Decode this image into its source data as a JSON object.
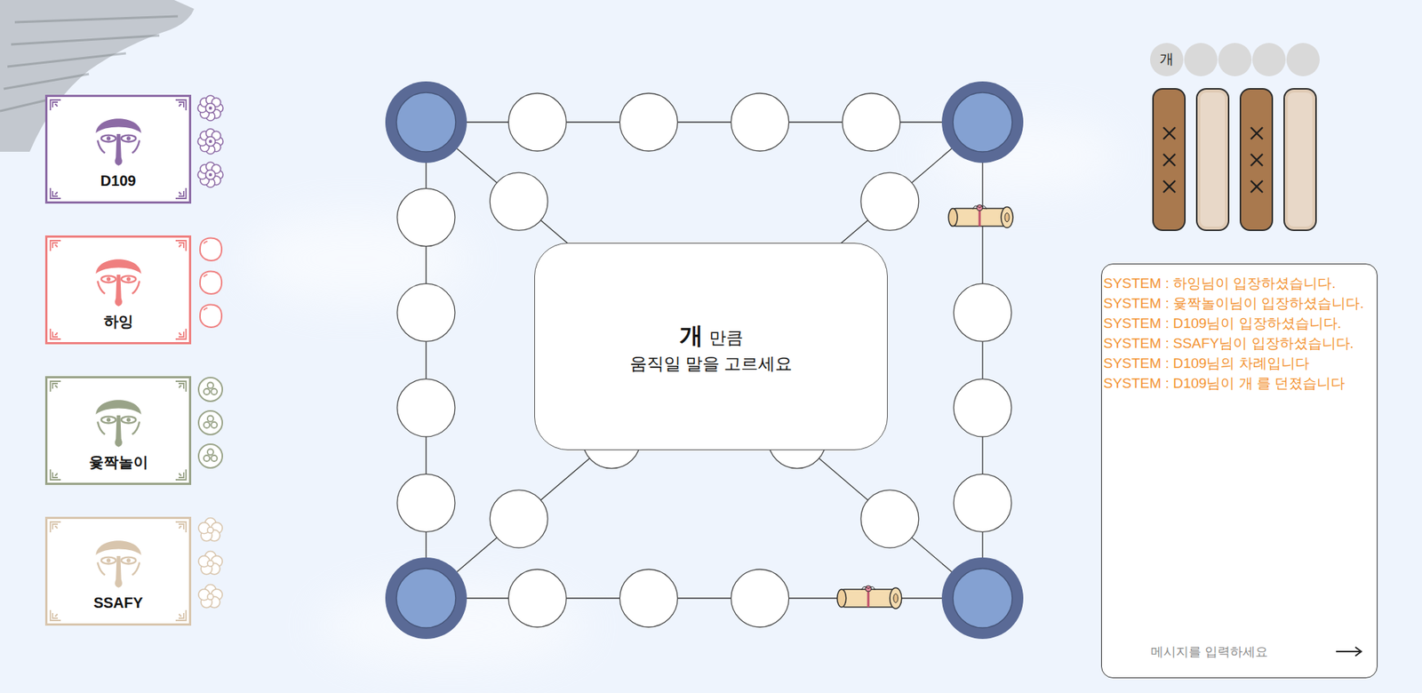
{
  "players": [
    {
      "name": "D109",
      "color": "#8c6aa5",
      "pieces": [
        {
          "waiting": true
        },
        {
          "waiting": true
        },
        {
          "waiting": true
        }
      ]
    },
    {
      "name": "하잉",
      "color": "#ef7f7f",
      "pieces": [
        {
          "waiting": true
        },
        {
          "waiting": true
        },
        {
          "waiting": true
        }
      ]
    },
    {
      "name": "윷짝놀이",
      "color": "#99a388",
      "pieces": [
        {
          "waiting": true
        },
        {
          "waiting": true
        },
        {
          "waiting": true
        }
      ]
    },
    {
      "name": "SSAFY",
      "color": "#d8c5ad",
      "pieces": [
        {
          "waiting": true
        },
        {
          "waiting": true
        },
        {
          "waiting": true
        }
      ]
    }
  ],
  "board": {
    "nodes": [
      {
        "kind": "corner",
        "scroll": false
      },
      {
        "kind": "station",
        "scroll": false
      },
      {
        "kind": "station",
        "scroll": false
      },
      {
        "kind": "station",
        "scroll": false
      },
      {
        "kind": "station",
        "scroll": true
      },
      {
        "kind": "corner",
        "scroll": false
      },
      {
        "kind": "station",
        "scroll": false
      },
      {
        "kind": "station",
        "scroll": false
      },
      {
        "kind": "station",
        "scroll": false
      },
      {
        "kind": "station",
        "scroll": false
      },
      {
        "kind": "corner",
        "scroll": false
      },
      {
        "kind": "station",
        "scroll": false
      },
      {
        "kind": "station",
        "scroll": false
      },
      {
        "kind": "station",
        "scroll": false
      },
      {
        "kind": "station",
        "scroll": false
      },
      {
        "kind": "corner",
        "scroll": false
      },
      {
        "kind": "station",
        "scroll": false
      },
      {
        "kind": "station",
        "scroll": false
      },
      {
        "kind": "station",
        "scroll": false
      },
      {
        "kind": "station",
        "scroll": true
      },
      {
        "kind": "station",
        "scroll": false
      },
      {
        "kind": "station",
        "scroll": false
      },
      {
        "kind": "center",
        "scroll": false
      },
      {
        "kind": "station",
        "scroll": false
      },
      {
        "kind": "station",
        "scroll": false
      },
      {
        "kind": "station",
        "scroll": false
      },
      {
        "kind": "station",
        "scroll": false
      },
      {
        "kind": "station",
        "scroll": false
      },
      {
        "kind": "station",
        "scroll": false
      }
    ]
  },
  "prompt": {
    "result": "개",
    "unit": "만큼",
    "instruction": "움직일 말을 고르세요"
  },
  "throw": {
    "results": [
      {
        "label": "개",
        "filled": true
      },
      {
        "filled": false
      },
      {
        "filled": false
      },
      {
        "filled": false
      },
      {
        "filled": false
      }
    ],
    "sticks": [
      {
        "kind": "back"
      },
      {
        "kind": "front"
      },
      {
        "kind": "back"
      },
      {
        "kind": "front"
      }
    ]
  },
  "chat": {
    "messages": [
      "SYSTEM : 하잉님이 입장하셨습니다.",
      "SYSTEM : 윷짝놀이님이 입장하셨습니다.",
      "SYSTEM : D109님이 입장하셨습니다.",
      "SYSTEM : SSAFY님이 입장하셨습니다.",
      "SYSTEM : D109님의 차례입니다",
      "SYSTEM : D109님이 개 를 던졌습니다"
    ],
    "placeholder": "메시지를 입력하세요"
  }
}
